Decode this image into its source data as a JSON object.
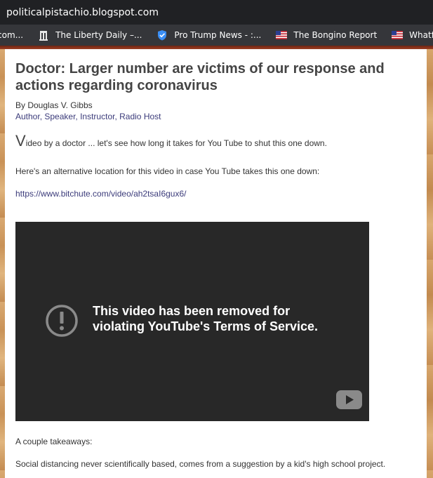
{
  "browser": {
    "url": "politicalpistachio.blogspot.com",
    "bookmarks": [
      {
        "label": "com...",
        "icon": "site-favicon"
      },
      {
        "label": "The Liberty Daily –...",
        "icon": "liberty-bell-icon"
      },
      {
        "label": "Pro Trump News - :...",
        "icon": "shield-check-icon"
      },
      {
        "label": "The Bongino Report",
        "icon": "us-flag-icon"
      },
      {
        "label": "Whatfinger – Wh",
        "icon": "us-flag-icon"
      }
    ]
  },
  "post": {
    "title": "Doctor: Larger number are victims of our response and actions regarding coronavirus",
    "byline": "By Douglas V. Gibbs",
    "roles": [
      "Author",
      "Speaker",
      "Instructor",
      "Radio Host"
    ],
    "intro_dropcap": "V",
    "intro_rest": "ideo by a doctor ... let's see how long it takes for You Tube to shut this one down.",
    "alt_text": "Here's an alternative location for this video in case You Tube takes this one down:",
    "link": "https://www.bitchute.com/video/ah2tsaI6gux6/",
    "video_message": "This video has been removed for violating YouTube's Terms of Service.",
    "takeaways": "A couple takeaways:",
    "social": "Social distancing never scientifically based, comes from a suggestion by a kid's high school project."
  },
  "colors": {
    "chrome_bg": "#202124",
    "bookmarks_bg": "#35363a",
    "title": "#444444",
    "link": "#3b3b7a",
    "video_bg": "#282828"
  }
}
